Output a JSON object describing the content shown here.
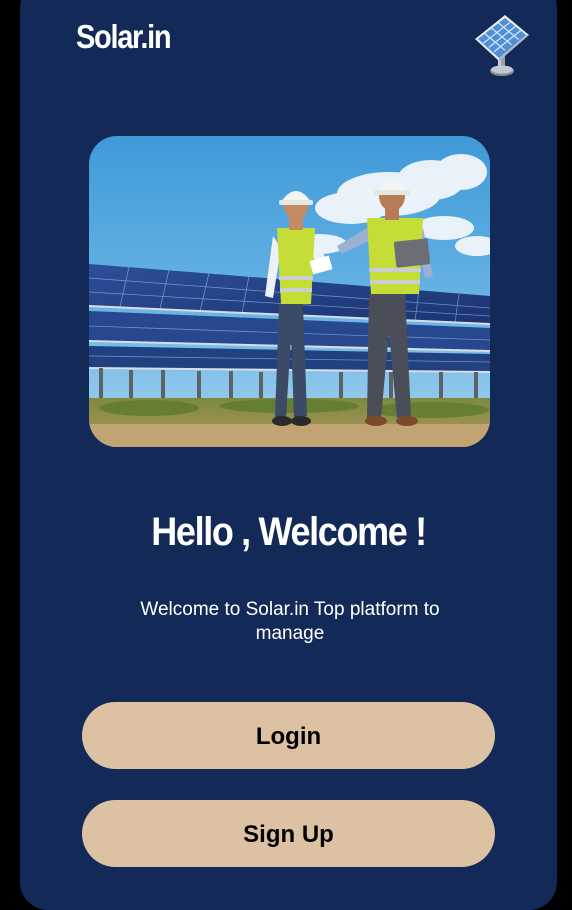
{
  "app": {
    "brand": "Solar.in"
  },
  "header": {
    "icon": "solar-panel-icon"
  },
  "hero": {
    "image": "engineers-at-solar-farm-photo"
  },
  "welcome": {
    "headline": "Hello , Welcome !",
    "subtitle": "Welcome to Solar.in Top platform to manage"
  },
  "actions": {
    "login_label": "Login",
    "signup_label": "Sign Up"
  },
  "colors": {
    "background": "#132a58",
    "button": "#dcc2a2",
    "text": "#ffffff"
  }
}
